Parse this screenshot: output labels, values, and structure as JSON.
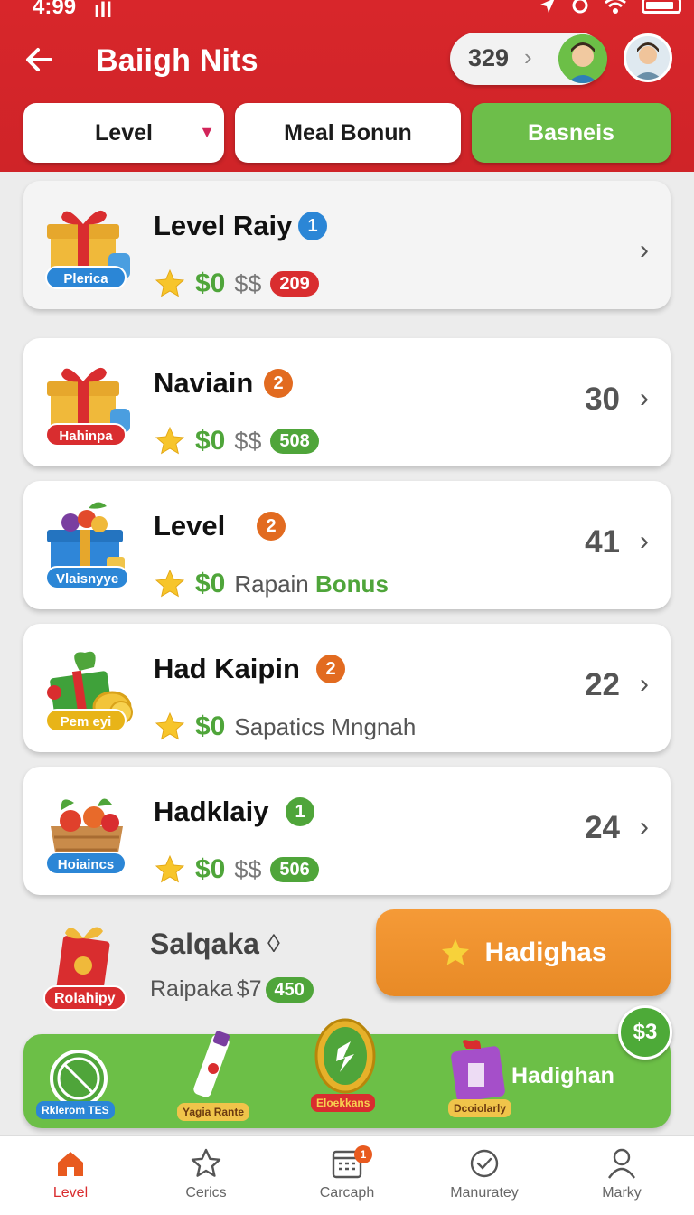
{
  "status_bar": {
    "time": "4:99",
    "signal": "ıll"
  },
  "header": {
    "title": "Baiigh Nits",
    "coin_count": "329",
    "tabs": [
      {
        "label": "Level",
        "active": false
      },
      {
        "label": "Meal Bonun",
        "active": false
      },
      {
        "label": "Basneis",
        "active": true
      }
    ]
  },
  "cards": [
    {
      "name": "Level Raiy",
      "badge": "1",
      "badge_color": "#2b86d6",
      "tag": "Plerica",
      "tag_color": "#2b86d6",
      "money": "$0",
      "currency": "$$",
      "pill": "209",
      "pill_color": "#d92d2f",
      "right_value": ""
    },
    {
      "name": "Naviain",
      "badge": "2",
      "badge_color": "#e26b20",
      "tag": "Hahinpa",
      "tag_color": "#d92d2f",
      "money": "$0",
      "currency": "$$",
      "pill": "508",
      "pill_color": "#4fa53a",
      "right_value": "30"
    },
    {
      "name": "Level",
      "badge": "2",
      "badge_color": "#e26b20",
      "tag": "Vlaisnyye",
      "tag_color": "#2b86d6",
      "money": "$0",
      "subtext_plain": "Rapain",
      "subtext_bold": "Bonus",
      "right_value": "41"
    },
    {
      "name": "Had Kaipin",
      "badge": "2",
      "badge_color": "#e26b20",
      "tag": "Pem eyi",
      "tag_color": "#e8b418",
      "money": "$0",
      "subtext_plain": "Sapatics Mngnah",
      "right_value": "22"
    },
    {
      "name": "Hadklaiy",
      "badge": "1",
      "badge_color": "#4fa53a",
      "tag": "Hoiaincs",
      "tag_color": "#2b86d6",
      "money": "$0",
      "currency": "$$",
      "pill": "506",
      "pill_color": "#4fa53a",
      "right_value": "24"
    }
  ],
  "promo": {
    "tag": "Rolahipy",
    "title": "Salqaka",
    "subtitle": "Raipaka",
    "amount": "$7",
    "pill": "450",
    "button_label": "Hadighas"
  },
  "green_banner": {
    "text": "Hadighan",
    "badge": "$3",
    "tag1": "Rklerom TES",
    "tag2": "Yagia Rante",
    "tag3": "Eloekkans",
    "tag4": "Dcoiolarly"
  },
  "bottom_nav": [
    {
      "label": "Level",
      "icon": "home-icon",
      "active": true
    },
    {
      "label": "Cerics",
      "icon": "star-outline-icon",
      "active": false
    },
    {
      "label": "Carcaph",
      "icon": "calendar-icon",
      "active": false,
      "badge": "1"
    },
    {
      "label": "Manuratey",
      "icon": "check-circle-icon",
      "active": false
    },
    {
      "label": "Marky",
      "icon": "user-icon",
      "active": false
    }
  ],
  "colors": {
    "brand_red": "#d8262b",
    "accent_green": "#6cbf47",
    "accent_orange": "#f0922f"
  }
}
